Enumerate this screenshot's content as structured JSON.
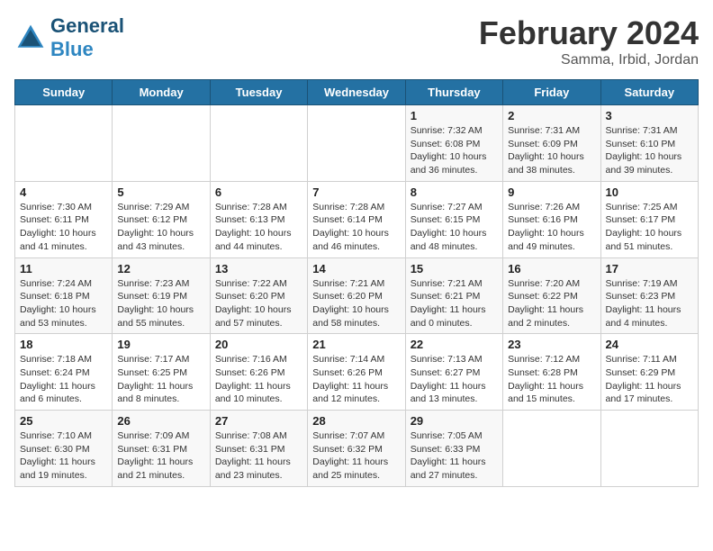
{
  "logo": {
    "general": "General",
    "blue": "Blue"
  },
  "header": {
    "month": "February 2024",
    "location": "Samma, Irbid, Jordan"
  },
  "days_of_week": [
    "Sunday",
    "Monday",
    "Tuesday",
    "Wednesday",
    "Thursday",
    "Friday",
    "Saturday"
  ],
  "weeks": [
    [
      {
        "day": "",
        "content": ""
      },
      {
        "day": "",
        "content": ""
      },
      {
        "day": "",
        "content": ""
      },
      {
        "day": "",
        "content": ""
      },
      {
        "day": "1",
        "content": "Sunrise: 7:32 AM\nSunset: 6:08 PM\nDaylight: 10 hours\nand 36 minutes."
      },
      {
        "day": "2",
        "content": "Sunrise: 7:31 AM\nSunset: 6:09 PM\nDaylight: 10 hours\nand 38 minutes."
      },
      {
        "day": "3",
        "content": "Sunrise: 7:31 AM\nSunset: 6:10 PM\nDaylight: 10 hours\nand 39 minutes."
      }
    ],
    [
      {
        "day": "4",
        "content": "Sunrise: 7:30 AM\nSunset: 6:11 PM\nDaylight: 10 hours\nand 41 minutes."
      },
      {
        "day": "5",
        "content": "Sunrise: 7:29 AM\nSunset: 6:12 PM\nDaylight: 10 hours\nand 43 minutes."
      },
      {
        "day": "6",
        "content": "Sunrise: 7:28 AM\nSunset: 6:13 PM\nDaylight: 10 hours\nand 44 minutes."
      },
      {
        "day": "7",
        "content": "Sunrise: 7:28 AM\nSunset: 6:14 PM\nDaylight: 10 hours\nand 46 minutes."
      },
      {
        "day": "8",
        "content": "Sunrise: 7:27 AM\nSunset: 6:15 PM\nDaylight: 10 hours\nand 48 minutes."
      },
      {
        "day": "9",
        "content": "Sunrise: 7:26 AM\nSunset: 6:16 PM\nDaylight: 10 hours\nand 49 minutes."
      },
      {
        "day": "10",
        "content": "Sunrise: 7:25 AM\nSunset: 6:17 PM\nDaylight: 10 hours\nand 51 minutes."
      }
    ],
    [
      {
        "day": "11",
        "content": "Sunrise: 7:24 AM\nSunset: 6:18 PM\nDaylight: 10 hours\nand 53 minutes."
      },
      {
        "day": "12",
        "content": "Sunrise: 7:23 AM\nSunset: 6:19 PM\nDaylight: 10 hours\nand 55 minutes."
      },
      {
        "day": "13",
        "content": "Sunrise: 7:22 AM\nSunset: 6:20 PM\nDaylight: 10 hours\nand 57 minutes."
      },
      {
        "day": "14",
        "content": "Sunrise: 7:21 AM\nSunset: 6:20 PM\nDaylight: 10 hours\nand 58 minutes."
      },
      {
        "day": "15",
        "content": "Sunrise: 7:21 AM\nSunset: 6:21 PM\nDaylight: 11 hours\nand 0 minutes."
      },
      {
        "day": "16",
        "content": "Sunrise: 7:20 AM\nSunset: 6:22 PM\nDaylight: 11 hours\nand 2 minutes."
      },
      {
        "day": "17",
        "content": "Sunrise: 7:19 AM\nSunset: 6:23 PM\nDaylight: 11 hours\nand 4 minutes."
      }
    ],
    [
      {
        "day": "18",
        "content": "Sunrise: 7:18 AM\nSunset: 6:24 PM\nDaylight: 11 hours\nand 6 minutes."
      },
      {
        "day": "19",
        "content": "Sunrise: 7:17 AM\nSunset: 6:25 PM\nDaylight: 11 hours\nand 8 minutes."
      },
      {
        "day": "20",
        "content": "Sunrise: 7:16 AM\nSunset: 6:26 PM\nDaylight: 11 hours\nand 10 minutes."
      },
      {
        "day": "21",
        "content": "Sunrise: 7:14 AM\nSunset: 6:26 PM\nDaylight: 11 hours\nand 12 minutes."
      },
      {
        "day": "22",
        "content": "Sunrise: 7:13 AM\nSunset: 6:27 PM\nDaylight: 11 hours\nand 13 minutes."
      },
      {
        "day": "23",
        "content": "Sunrise: 7:12 AM\nSunset: 6:28 PM\nDaylight: 11 hours\nand 15 minutes."
      },
      {
        "day": "24",
        "content": "Sunrise: 7:11 AM\nSunset: 6:29 PM\nDaylight: 11 hours\nand 17 minutes."
      }
    ],
    [
      {
        "day": "25",
        "content": "Sunrise: 7:10 AM\nSunset: 6:30 PM\nDaylight: 11 hours\nand 19 minutes."
      },
      {
        "day": "26",
        "content": "Sunrise: 7:09 AM\nSunset: 6:31 PM\nDaylight: 11 hours\nand 21 minutes."
      },
      {
        "day": "27",
        "content": "Sunrise: 7:08 AM\nSunset: 6:31 PM\nDaylight: 11 hours\nand 23 minutes."
      },
      {
        "day": "28",
        "content": "Sunrise: 7:07 AM\nSunset: 6:32 PM\nDaylight: 11 hours\nand 25 minutes."
      },
      {
        "day": "29",
        "content": "Sunrise: 7:05 AM\nSunset: 6:33 PM\nDaylight: 11 hours\nand 27 minutes."
      },
      {
        "day": "",
        "content": ""
      },
      {
        "day": "",
        "content": ""
      }
    ]
  ]
}
